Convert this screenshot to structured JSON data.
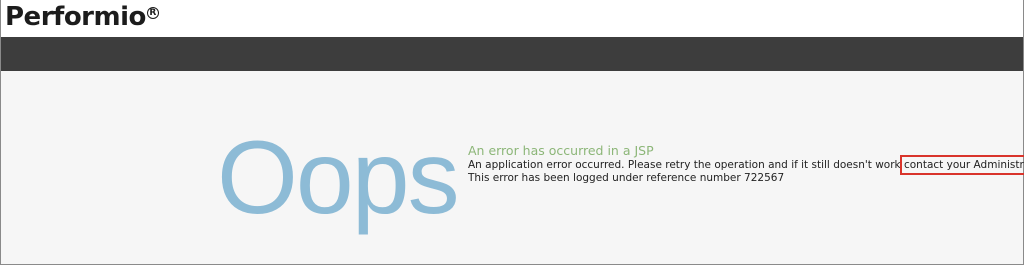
{
  "header": {
    "logo_text": "Performio",
    "logo_reg": "R"
  },
  "error": {
    "big_word": "Oops",
    "title": "An error has occurred in a JSP",
    "line1_prefix": "An application error occurred. Please retry the operation and if it still doesn't work",
    "line1_link": "contact your Administrator.",
    "line2": "This error has been logged under reference number 722567"
  },
  "colors": {
    "navbar": "#3d3d3d",
    "content_bg": "#f6f6f6",
    "oops": "#8dbbd6",
    "title": "#8cb678",
    "highlight_box": "#d9342b"
  }
}
